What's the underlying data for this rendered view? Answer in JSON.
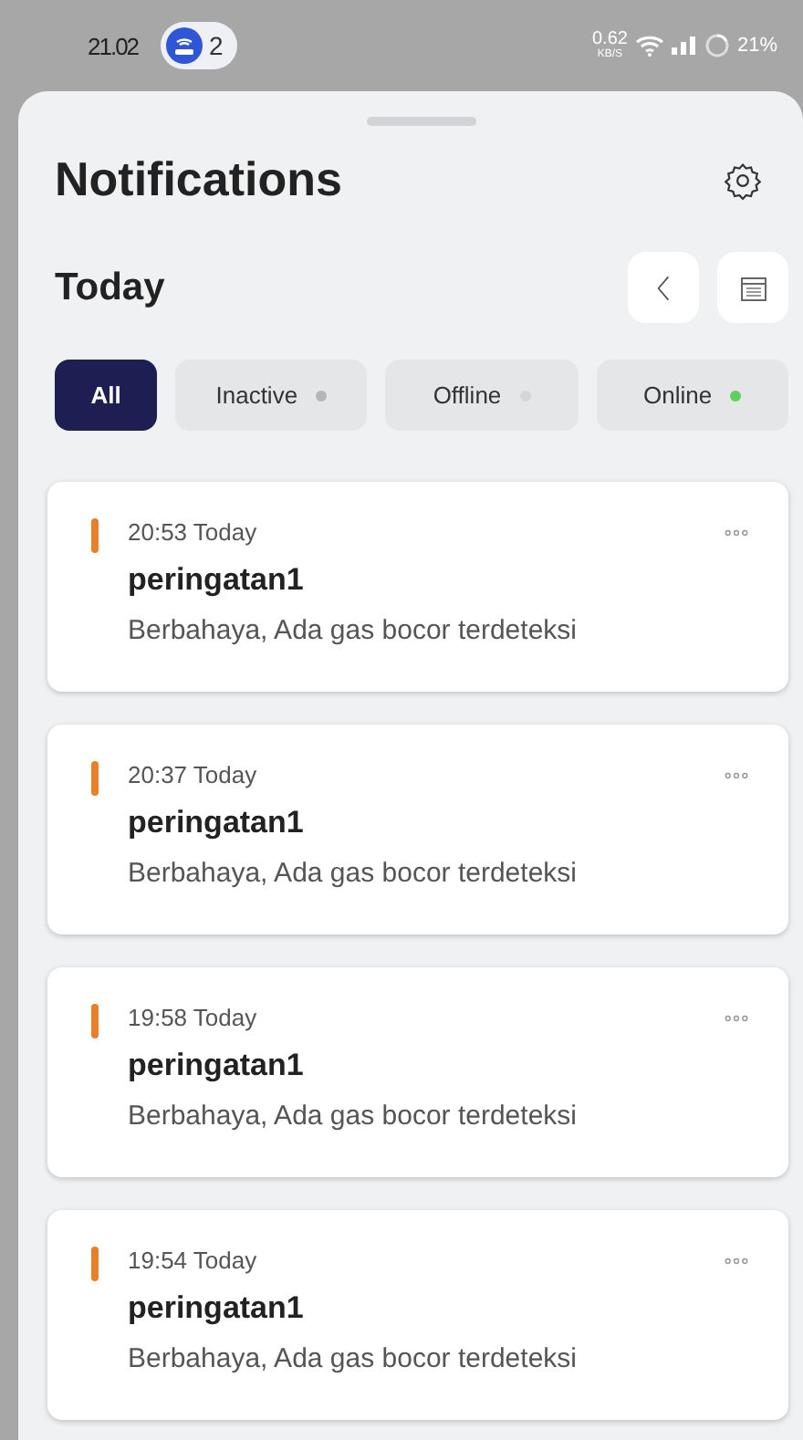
{
  "status_bar": {
    "time": "21.02",
    "badge_count": "2",
    "speed": "0.62",
    "speed_unit": "KB/S",
    "battery": "21%"
  },
  "header": {
    "title": "Notifications"
  },
  "section": {
    "title": "Today"
  },
  "filters": [
    {
      "label": "All",
      "selected": true
    },
    {
      "label": "Inactive",
      "selected": false,
      "color": "#b5b5b5"
    },
    {
      "label": "Offline",
      "selected": false,
      "color": "#d6d6d6"
    },
    {
      "label": "Online",
      "selected": false,
      "color": "#5fcf5f"
    }
  ],
  "notifications": [
    {
      "time": "20:53 Today",
      "title": "peringatan1",
      "message": "Berbahaya, Ada gas bocor terdeteksi"
    },
    {
      "time": "20:37 Today",
      "title": "peringatan1",
      "message": "Berbahaya, Ada gas bocor terdeteksi"
    },
    {
      "time": "19:58 Today",
      "title": "peringatan1",
      "message": "Berbahaya, Ada gas bocor terdeteksi"
    },
    {
      "time": "19:54 Today",
      "title": "peringatan1",
      "message": "Berbahaya, Ada gas bocor terdeteksi"
    }
  ]
}
